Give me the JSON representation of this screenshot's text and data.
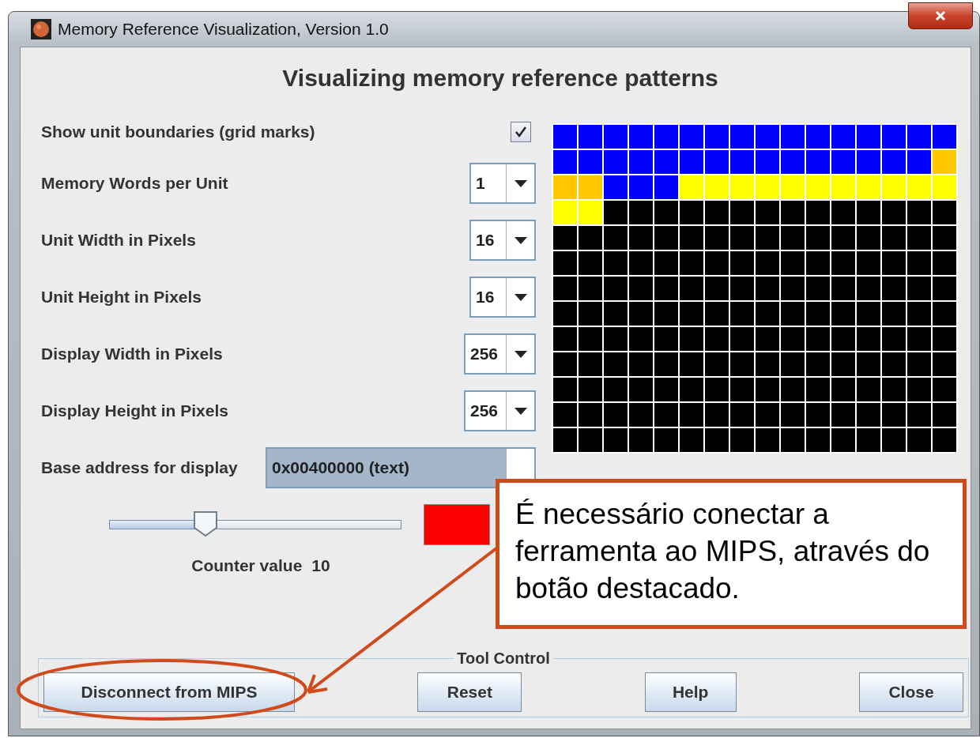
{
  "window": {
    "title": "Memory Reference Visualization, Version 1.0"
  },
  "heading": "Visualizing memory reference patterns",
  "options": [
    {
      "kind": "checkbox",
      "label": "Show unit boundaries (grid marks)",
      "checked": true
    },
    {
      "kind": "combo",
      "label": "Memory Words per Unit",
      "value": "1"
    },
    {
      "kind": "combo",
      "label": "Unit Width in Pixels",
      "value": "16"
    },
    {
      "kind": "combo",
      "label": "Unit Height in Pixels",
      "value": "16"
    },
    {
      "kind": "combo",
      "label": "Display Width in Pixels",
      "value": "256"
    },
    {
      "kind": "combo",
      "label": "Display Height in Pixels",
      "value": "256"
    },
    {
      "kind": "address",
      "label": "Base address for display",
      "value": "0x00400000 (text)"
    }
  ],
  "slider": {
    "level": 0.33
  },
  "counter": {
    "label": "Counter value",
    "value": "10",
    "color": "#ff0000"
  },
  "grid": {
    "rows": [
      [
        {
          "color": "#0000ff"
        },
        {
          "color": "#0000ff"
        },
        {
          "color": "#0000ff"
        },
        {
          "color": "#0000ff"
        },
        {
          "color": "#0000ff"
        },
        {
          "color": "#0000ff"
        },
        {
          "color": "#0000ff"
        },
        {
          "color": "#0000ff"
        },
        {
          "color": "#0000ff"
        },
        {
          "color": "#0000ff"
        },
        {
          "color": "#0000ff"
        },
        {
          "color": "#0000ff"
        },
        {
          "color": "#0000ff"
        },
        {
          "color": "#0000ff"
        },
        {
          "color": "#0000ff"
        },
        {
          "color": "#0000ff"
        }
      ],
      [
        {
          "color": "#0000ff"
        },
        {
          "color": "#0000ff"
        },
        {
          "color": "#0000ff"
        },
        {
          "color": "#0000ff"
        },
        {
          "color": "#0000ff"
        },
        {
          "color": "#0000ff"
        },
        {
          "color": "#0000ff"
        },
        {
          "color": "#0000ff"
        },
        {
          "color": "#0000ff"
        },
        {
          "color": "#0000ff"
        },
        {
          "color": "#0000ff"
        },
        {
          "color": "#0000ff"
        },
        {
          "color": "#0000ff"
        },
        {
          "color": "#0000ff"
        },
        {
          "color": "#0000ff"
        },
        {
          "color": "#ffc800"
        }
      ],
      [
        {
          "color": "#ffc800"
        },
        {
          "color": "#ffc800"
        },
        {
          "color": "#0000ff"
        },
        {
          "color": "#0000ff"
        },
        {
          "color": "#0000ff"
        },
        {
          "color": "#ffff00"
        },
        {
          "color": "#ffff00"
        },
        {
          "color": "#ffff00"
        },
        {
          "color": "#ffff00"
        },
        {
          "color": "#ffff00"
        },
        {
          "color": "#ffff00"
        },
        {
          "color": "#ffff00"
        },
        {
          "color": "#ffff00"
        },
        {
          "color": "#ffff00"
        },
        {
          "color": "#ffff00"
        },
        {
          "color": "#ffff00"
        }
      ],
      [
        {
          "color": "#ffff00"
        },
        {
          "color": "#ffff00"
        },
        {
          "color": "#000000"
        },
        {
          "color": "#000000"
        },
        {
          "color": "#000000"
        },
        {
          "color": "#000000"
        },
        {
          "color": "#000000"
        },
        {
          "color": "#000000"
        },
        {
          "color": "#000000"
        },
        {
          "color": "#000000"
        },
        {
          "color": "#000000"
        },
        {
          "color": "#000000"
        },
        {
          "color": "#000000"
        },
        {
          "color": "#000000"
        },
        {
          "color": "#000000"
        },
        {
          "color": "#000000"
        }
      ],
      [
        {
          "color": "#000000"
        },
        {
          "color": "#000000"
        },
        {
          "color": "#000000"
        },
        {
          "color": "#000000"
        },
        {
          "color": "#000000"
        },
        {
          "color": "#000000"
        },
        {
          "color": "#000000"
        },
        {
          "color": "#000000"
        },
        {
          "color": "#000000"
        },
        {
          "color": "#000000"
        },
        {
          "color": "#000000"
        },
        {
          "color": "#000000"
        },
        {
          "color": "#000000"
        },
        {
          "color": "#000000"
        },
        {
          "color": "#000000"
        },
        {
          "color": "#000000"
        }
      ],
      [
        {
          "color": "#000000"
        },
        {
          "color": "#000000"
        },
        {
          "color": "#000000"
        },
        {
          "color": "#000000"
        },
        {
          "color": "#000000"
        },
        {
          "color": "#000000"
        },
        {
          "color": "#000000"
        },
        {
          "color": "#000000"
        },
        {
          "color": "#000000"
        },
        {
          "color": "#000000"
        },
        {
          "color": "#000000"
        },
        {
          "color": "#000000"
        },
        {
          "color": "#000000"
        },
        {
          "color": "#000000"
        },
        {
          "color": "#000000"
        },
        {
          "color": "#000000"
        }
      ],
      [
        {
          "color": "#000000"
        },
        {
          "color": "#000000"
        },
        {
          "color": "#000000"
        },
        {
          "color": "#000000"
        },
        {
          "color": "#000000"
        },
        {
          "color": "#000000"
        },
        {
          "color": "#000000"
        },
        {
          "color": "#000000"
        },
        {
          "color": "#000000"
        },
        {
          "color": "#000000"
        },
        {
          "color": "#000000"
        },
        {
          "color": "#000000"
        },
        {
          "color": "#000000"
        },
        {
          "color": "#000000"
        },
        {
          "color": "#000000"
        },
        {
          "color": "#000000"
        }
      ],
      [
        {
          "color": "#000000"
        },
        {
          "color": "#000000"
        },
        {
          "color": "#000000"
        },
        {
          "color": "#000000"
        },
        {
          "color": "#000000"
        },
        {
          "color": "#000000"
        },
        {
          "color": "#000000"
        },
        {
          "color": "#000000"
        },
        {
          "color": "#000000"
        },
        {
          "color": "#000000"
        },
        {
          "color": "#000000"
        },
        {
          "color": "#000000"
        },
        {
          "color": "#000000"
        },
        {
          "color": "#000000"
        },
        {
          "color": "#000000"
        },
        {
          "color": "#000000"
        }
      ],
      [
        {
          "color": "#000000"
        },
        {
          "color": "#000000"
        },
        {
          "color": "#000000"
        },
        {
          "color": "#000000"
        },
        {
          "color": "#000000"
        },
        {
          "color": "#000000"
        },
        {
          "color": "#000000"
        },
        {
          "color": "#000000"
        },
        {
          "color": "#000000"
        },
        {
          "color": "#000000"
        },
        {
          "color": "#000000"
        },
        {
          "color": "#000000"
        },
        {
          "color": "#000000"
        },
        {
          "color": "#000000"
        },
        {
          "color": "#000000"
        },
        {
          "color": "#000000"
        }
      ],
      [
        {
          "color": "#000000"
        },
        {
          "color": "#000000"
        },
        {
          "color": "#000000"
        },
        {
          "color": "#000000"
        },
        {
          "color": "#000000"
        },
        {
          "color": "#000000"
        },
        {
          "color": "#000000"
        },
        {
          "color": "#000000"
        },
        {
          "color": "#000000"
        },
        {
          "color": "#000000"
        },
        {
          "color": "#000000"
        },
        {
          "color": "#000000"
        },
        {
          "color": "#000000"
        },
        {
          "color": "#000000"
        },
        {
          "color": "#000000"
        },
        {
          "color": "#000000"
        }
      ],
      [
        {
          "color": "#000000"
        },
        {
          "color": "#000000"
        },
        {
          "color": "#000000"
        },
        {
          "color": "#000000"
        },
        {
          "color": "#000000"
        },
        {
          "color": "#000000"
        },
        {
          "color": "#000000"
        },
        {
          "color": "#000000"
        },
        {
          "color": "#000000"
        },
        {
          "color": "#000000"
        },
        {
          "color": "#000000"
        },
        {
          "color": "#000000"
        },
        {
          "color": "#000000"
        },
        {
          "color": "#000000"
        },
        {
          "color": "#000000"
        },
        {
          "color": "#000000"
        }
      ],
      [
        {
          "color": "#000000"
        },
        {
          "color": "#000000"
        },
        {
          "color": "#000000"
        },
        {
          "color": "#000000"
        },
        {
          "color": "#000000"
        },
        {
          "color": "#000000"
        },
        {
          "color": "#000000"
        },
        {
          "color": "#000000"
        },
        {
          "color": "#000000"
        },
        {
          "color": "#000000"
        },
        {
          "color": "#000000"
        },
        {
          "color": "#000000"
        },
        {
          "color": "#000000"
        },
        {
          "color": "#000000"
        },
        {
          "color": "#000000"
        },
        {
          "color": "#000000"
        }
      ],
      [
        {
          "color": "#000000"
        },
        {
          "color": "#000000"
        },
        {
          "color": "#000000"
        },
        {
          "color": "#000000"
        },
        {
          "color": "#000000"
        },
        {
          "color": "#000000"
        },
        {
          "color": "#000000"
        },
        {
          "color": "#000000"
        },
        {
          "color": "#000000"
        },
        {
          "color": "#000000"
        },
        {
          "color": "#000000"
        },
        {
          "color": "#000000"
        },
        {
          "color": "#000000"
        },
        {
          "color": "#000000"
        },
        {
          "color": "#000000"
        },
        {
          "color": "#000000"
        }
      ]
    ]
  },
  "tool_control": {
    "title": "Tool Control",
    "buttons": [
      "Disconnect from MIPS",
      "Reset",
      "Help",
      "Close"
    ]
  },
  "callout": {
    "text": "É necessário conectar a ferramenta ao MIPS, através do botão destacado."
  }
}
